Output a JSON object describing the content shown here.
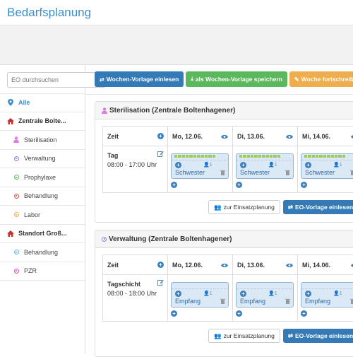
{
  "app": {
    "title": "Bedarfsplanung"
  },
  "search": {
    "placeholder": "EO durchsuchen"
  },
  "sidebar": {
    "items": [
      {
        "label": "Alle",
        "level": "top",
        "icon": "map-marker-icon",
        "color": "#3a8fd0"
      },
      {
        "label": "Zentrale Bolte...",
        "level": "top",
        "icon": "home-icon",
        "color": "#c9302c"
      },
      {
        "label": "Sterilisation",
        "level": "sub",
        "icon": "user-icon",
        "color": "#e07ce0"
      },
      {
        "label": "Verwaltung",
        "level": "sub",
        "icon": "circle-dot-icon",
        "color": "#9a7fd1"
      },
      {
        "label": "Prophylaxe",
        "level": "sub",
        "icon": "circle-dot-icon",
        "color": "#5cb85c"
      },
      {
        "label": "Behandlung",
        "level": "sub",
        "icon": "circle-dot-icon",
        "color": "#d9534f"
      },
      {
        "label": "Labor",
        "level": "sub",
        "icon": "circle-dot-icon",
        "color": "#f0ad4e"
      },
      {
        "label": "Standort Groß...",
        "level": "top",
        "icon": "home-icon",
        "color": "#c9302c"
      },
      {
        "label": "Behandlung",
        "level": "sub",
        "icon": "circle-dot-icon",
        "color": "#5bc0de"
      },
      {
        "label": "PZR",
        "level": "sub",
        "icon": "circle-dot-icon",
        "color": "#e04fc0"
      }
    ]
  },
  "toolbar": {
    "load_week_template": "Wochen-Vorlage einlesen",
    "save_week_template": "als Wochen-Vorlage speichern",
    "continue_week": "Woche fortschreiben"
  },
  "panels": [
    {
      "title": "Sterilisation (Zentrale Boltenhagener)",
      "icon": "user-icon",
      "icon_color": "#e07ce0",
      "col_header": "Zeit",
      "days": [
        "Mo, 12.06.",
        "Di, 13.06.",
        "Mi, 14.06."
      ],
      "shift": {
        "name": "Tag",
        "time": "08:00 - 17:00 Uhr"
      },
      "cards": [
        {
          "label": "Schwester",
          "count": "1"
        },
        {
          "label": "Schwester",
          "count": "1"
        },
        {
          "label": "Schwester",
          "count": "1"
        }
      ],
      "btn_planning": "zur Einsatzplanung",
      "btn_eo_template": "EO-Vorlage einlesen"
    },
    {
      "title": "Verwaltung (Zentrale Boltenhagener)",
      "icon": "circle-dot-icon",
      "icon_color": "#9a7fd1",
      "col_header": "Zeit",
      "days": [
        "Mo, 12.06.",
        "Di, 13.06.",
        "Mi, 14.06."
      ],
      "shift": {
        "name": "Tagschicht",
        "time": "08:00 - 18:00 Uhr"
      },
      "cards": [
        {
          "label": "Empfang",
          "count": "1"
        },
        {
          "label": "Empfang",
          "count": "1"
        },
        {
          "label": "Empfang",
          "count": "1"
        }
      ],
      "btn_planning": "zur Einsatzplanung",
      "btn_eo_template": "EO-Vorlage einlesen"
    }
  ],
  "colors": {
    "accent": "#337ab7",
    "success": "#5cb85c",
    "warning": "#f0ad4e",
    "title": "#3a8fd0"
  }
}
